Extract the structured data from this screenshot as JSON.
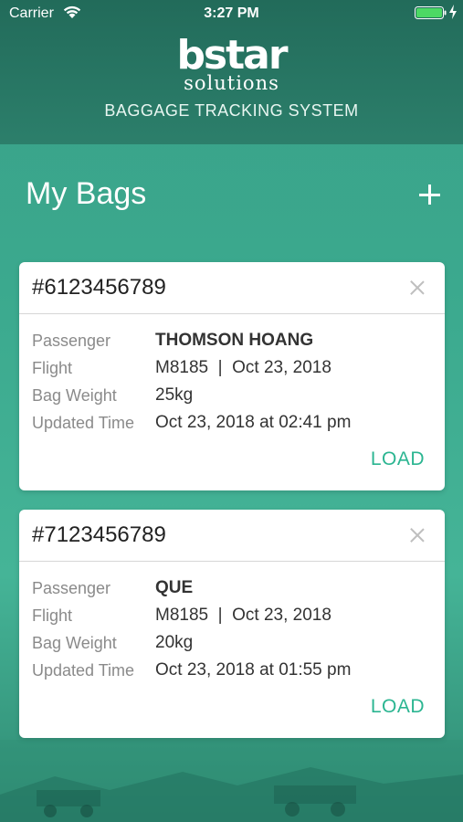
{
  "status_bar": {
    "carrier": "Carrier",
    "time": "3:27 PM"
  },
  "header": {
    "logo_word": "bstar",
    "logo_sub": "solutions",
    "subtitle": "BAGGAGE TRACKING SYSTEM"
  },
  "page": {
    "title": "My Bags",
    "add_icon": "plus-icon"
  },
  "labels": {
    "passenger": "Passenger",
    "flight": "Flight",
    "bag_weight": "Bag Weight",
    "updated_time": "Updated Time"
  },
  "bags": [
    {
      "id": "#6123456789",
      "passenger": "THOMSON HOANG",
      "flight": "M8185  |  Oct 23, 2018",
      "weight": "25kg",
      "updated": "Oct 23, 2018 at 02:41 pm",
      "action": "LOAD"
    },
    {
      "id": "#7123456789",
      "passenger": "QUE",
      "flight": "M8185  |  Oct 23, 2018",
      "weight": "20kg",
      "updated": "Oct 23, 2018 at 01:55 pm",
      "action": "LOAD"
    }
  ],
  "colors": {
    "header_bg": "#226b5a",
    "body_bg": "#3ba98e",
    "accent": "#2bb591",
    "battery": "#4cd964"
  }
}
